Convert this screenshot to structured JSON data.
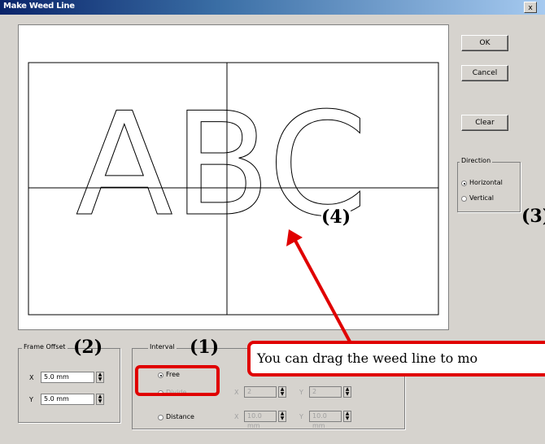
{
  "window": {
    "title": "Make Weed Line",
    "close_label": "x"
  },
  "buttons": {
    "ok": "OK",
    "cancel": "Cancel",
    "clear": "Clear"
  },
  "canvas": {
    "text": "ABC"
  },
  "direction": {
    "title": "Direction",
    "horizontal": "Horizontal",
    "vertical": "Vertical",
    "selected": "Horizontal"
  },
  "frame_offset": {
    "title": "Frame Offset",
    "x_label": "X",
    "x_value": "5.0 mm",
    "y_label": "Y",
    "y_value": "5.0 mm"
  },
  "interval": {
    "title": "Interval",
    "free": "Free",
    "divide": "Divide",
    "distance": "Distance",
    "selected": "Free",
    "divide_x_label": "X",
    "divide_x_value": "2",
    "divide_y_label": "Y",
    "divide_y_value": "2",
    "distance_x_label": "X",
    "distance_x_value": "10.0 mm",
    "distance_y_label": "Y",
    "distance_y_value": "10.0 mm"
  },
  "annotations": {
    "one": "(1)",
    "two": "(2)",
    "three": "(3)",
    "four": "(4)",
    "callout": "You can drag the weed line to mo"
  },
  "colors": {
    "accent": "#e00000",
    "titlebar": "#0a246a",
    "dialog_bg": "#d6d3ce"
  }
}
